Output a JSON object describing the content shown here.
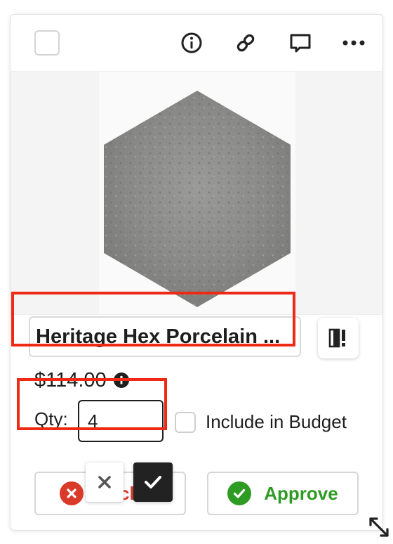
{
  "card": {
    "icons": [
      "info-icon",
      "link-icon",
      "comment-icon",
      "more-icon",
      "spec-sheet-icon",
      "info-icon",
      "close-icon",
      "check-icon",
      "resize-icon"
    ],
    "product_name": "Heritage Hex Porcelain ...",
    "price": "$114.00",
    "qty_label": "Qty:",
    "qty_value": "4",
    "include_budget_label": "Include in Budget",
    "decline_label": "Decline",
    "approve_label": "Approve"
  },
  "colors": {
    "highlight": "#ee2a14",
    "decline": "#d93a2a",
    "approve": "#2e9b24",
    "tile": "#8b8b8a"
  }
}
